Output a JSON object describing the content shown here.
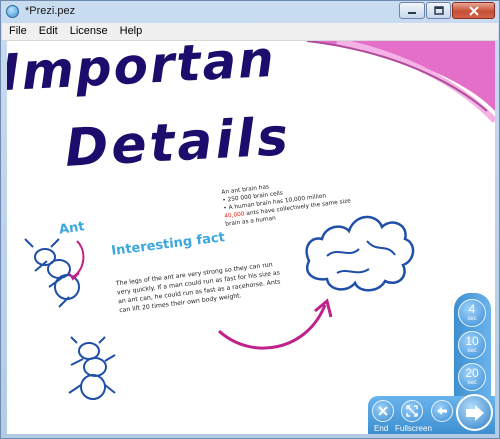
{
  "window": {
    "title": "*Prezi.pez",
    "app_icon": "prezi-app-icon",
    "controls": [
      "minimize-icon",
      "maximize-icon",
      "close-icon"
    ]
  },
  "menubar": {
    "items": [
      {
        "label": "File"
      },
      {
        "label": "Edit"
      },
      {
        "label": "License"
      },
      {
        "label": "Help"
      }
    ]
  },
  "canvas": {
    "title_line_1": "Importan",
    "title_line_2": "Details",
    "ant_label": "Ant",
    "fact_title": "Interesting fact",
    "fact_body": "The legs of the ant are very strong so they can run very quickly. If a man could run as fast for his size as an ant can, he could run as fast as a racehorse. Ants can lift 20 times their own body weight.",
    "brain_intro": "An ant brain has",
    "brain_bullet_1": "• 250 000 brain cells",
    "brain_bullet_2": "• A human brain has 10,000 million",
    "brain_highlight": "40,000",
    "brain_bullet_3": " ants have collectively the same size brain as a human",
    "colors": {
      "title_ink": "#1d0c6b",
      "accent_blue": "#3aa7e0",
      "drawing_blue": "#1f4fa6",
      "arrow_magenta": "#c0218a",
      "ring_pink": "#e46fc9",
      "highlight_red": "#e0241c"
    }
  },
  "timer": {
    "buttons": [
      {
        "num": "4",
        "unit": "sec"
      },
      {
        "num": "10",
        "unit": "sec"
      },
      {
        "num": "20",
        "unit": "sec"
      }
    ]
  },
  "controls": {
    "end_label": "End",
    "fullscreen_label": "Fullscreen",
    "icons": [
      "end-icon",
      "fullscreen-icon",
      "previous-arrow-icon",
      "next-arrow-icon"
    ]
  }
}
